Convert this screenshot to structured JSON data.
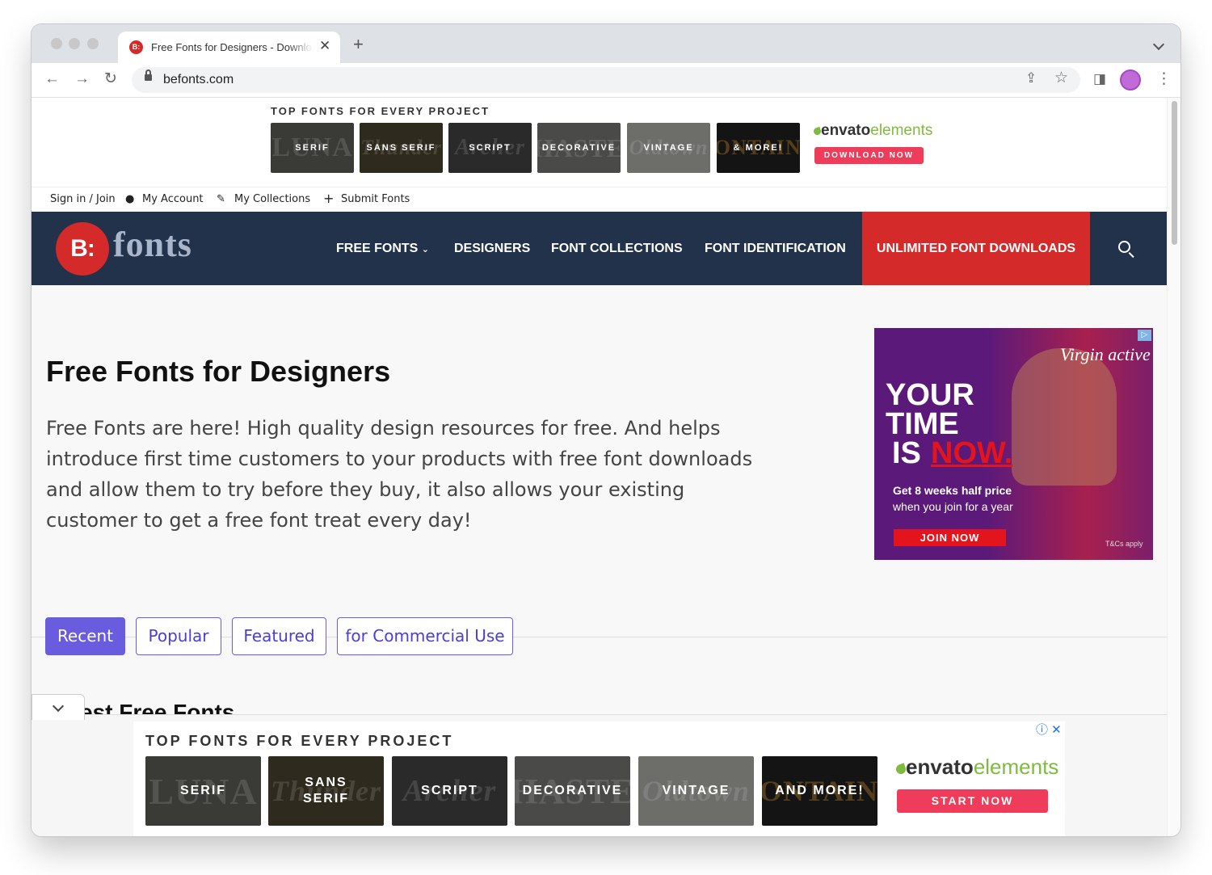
{
  "browser": {
    "tab_title": "Free Fonts for Designers - Download Free Fonts",
    "url": "befonts.com",
    "favicon_text": "B:"
  },
  "top_ad": {
    "heading": "TOP FONTS FOR EVERY PROJECT",
    "tiles": [
      {
        "label": "SERIF",
        "deco": "LUNA"
      },
      {
        "label": "SANS SERIF",
        "deco": "Thunder"
      },
      {
        "label": "SCRIPT",
        "deco": "Archer"
      },
      {
        "label": "DECORATIVE",
        "deco": "HASTE"
      },
      {
        "label": "VINTAGE",
        "deco": "Oldtown"
      },
      {
        "label": "& MORE!",
        "deco": "FONTAINE"
      }
    ],
    "brand_name": "envato",
    "brand_suffix": "elements",
    "cta": "DOWNLOAD NOW"
  },
  "userbar": {
    "signin": "Sign in / Join",
    "account": "My Account",
    "collections": "My Collections",
    "submit": "Submit Fonts"
  },
  "nav": {
    "logo_mark": "B:",
    "logo_word": "fonts",
    "free_fonts": "FREE FONTS",
    "designers": "DESIGNERS",
    "font_collections": "FONT COLLECTIONS",
    "font_identification": "FONT IDENTIFICATION",
    "unlimited": "UNLIMITED FONT DOWNLOADS"
  },
  "hero": {
    "title": "Free Fonts for Designers",
    "intro": "Free Fonts are here! High quality design resources for free. And helps introduce first time customers to your products with free font downloads and allow them to try before they buy, it also allows your existing customer to get a free font treat every day!"
  },
  "side_ad": {
    "brand": "Virgin active",
    "line1": "YOUR",
    "line2": "TIME",
    "line3_a": "IS",
    "line3_b": "NOW.",
    "offer_bold": "Get 8 weeks half price",
    "offer_rest": "when you join for a year",
    "cta": "JOIN NOW",
    "terms": "T&Cs apply",
    "badge": "▷"
  },
  "filter_tabs": [
    "Recent",
    "Popular",
    "Featured",
    "for Commercial Use"
  ],
  "section_heading": "Latest Free Fonts",
  "bottom_ad": {
    "heading": "TOP FONTS FOR EVERY PROJECT",
    "tiles": [
      {
        "label": "SERIF",
        "deco": "LUNA"
      },
      {
        "label": "SANS SERIF",
        "deco": "Thunder"
      },
      {
        "label": "SCRIPT",
        "deco": "Archer"
      },
      {
        "label": "DECORATIVE",
        "deco": "HASTE"
      },
      {
        "label": "VINTAGE",
        "deco": "Oldtown"
      },
      {
        "label": "AND MORE!",
        "deco": "FONTAINE"
      }
    ],
    "brand_name": "envato",
    "brand_suffix": "elements",
    "cta": "START NOW",
    "adchoices": "ⓘ ✕"
  },
  "colors": {
    "nav_bg": "#22324a",
    "accent_red": "#d42a2a",
    "tab_purple": "#6a5cde",
    "envato_green": "#7fbb3e",
    "cta_pink": "#ef3c5a"
  },
  "icons": [
    "back-icon",
    "forward-icon",
    "reload-icon",
    "lock-icon",
    "share-icon",
    "star-icon",
    "sidepanel-icon",
    "menu-dots-icon",
    "user-icon",
    "pin-icon",
    "plus-icon",
    "search-icon",
    "chevron-down-icon"
  ]
}
